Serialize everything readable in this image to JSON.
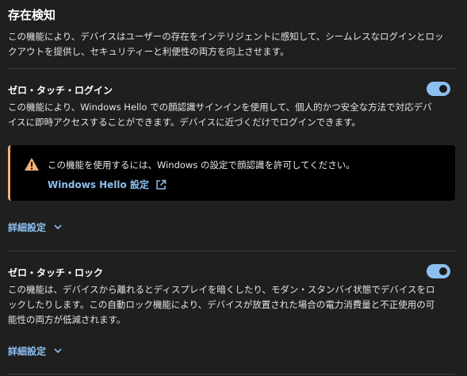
{
  "section": {
    "title": "存在検知",
    "description": "この機能により、デバイスはユーザーの存在をインテリジェントに感知して、シームレスなログインとロックアウトを提供し、セキュリティーと利便性の両方を向上させます。"
  },
  "zero_touch_login": {
    "title": "ゼロ・タッチ・ログイン",
    "description": "この機能により、Windows Hello での顔認識サインインを使用して、個人的かつ安全な方法で対応デバイスに即時アクセスすることができます。デバイスに近づくだけでログインできます。",
    "enabled": true,
    "warning": {
      "text": "この機能を使用するには、Windows の設定で顔認識を許可してください。",
      "link_label": "Windows Hello 設定",
      "accent_color": "#f2b179"
    },
    "advanced_label": "詳細設定"
  },
  "zero_touch_lock": {
    "title": "ゼロ・タッチ・ロック",
    "description": "この機能は、デバイスから離れるとディスプレイを暗くしたり、モダン・スタンバイ状態でデバイスをロックしたりします。この自動ロック機能により、デバイスが放置された場合の電力消費量と不正使用の可能性の両方が低減されます。",
    "enabled": true,
    "advanced_label": "詳細設定"
  },
  "colors": {
    "background": "#1f1f1f",
    "accent": "#8cc0f0",
    "warning": "#f2b179"
  },
  "icons": {
    "warning": "warning-triangle-icon",
    "external_link": "external-link-icon",
    "chevron": "chevron-down-icon"
  }
}
